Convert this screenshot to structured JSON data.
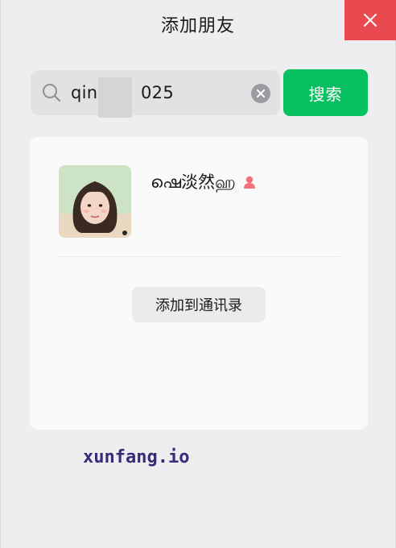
{
  "window": {
    "title": "添加朋友"
  },
  "search": {
    "value": "qing",
    "value_suffix": "025",
    "button_label": "搜索"
  },
  "result": {
    "nickname": "ഷെ淡然ஹ",
    "gender": "female",
    "add_button_label": "添加到通讯录"
  },
  "watermark": "xunfang.io",
  "icons": {
    "close": "close-icon",
    "search": "search-icon",
    "clear": "clear-icon",
    "gender": "female-user-icon"
  },
  "colors": {
    "primary": "#07c160",
    "close": "#e84a4f",
    "background": "#eeeef0",
    "card": "#fafafa",
    "gender": "#f0727a",
    "watermark": "#3a2a78"
  }
}
